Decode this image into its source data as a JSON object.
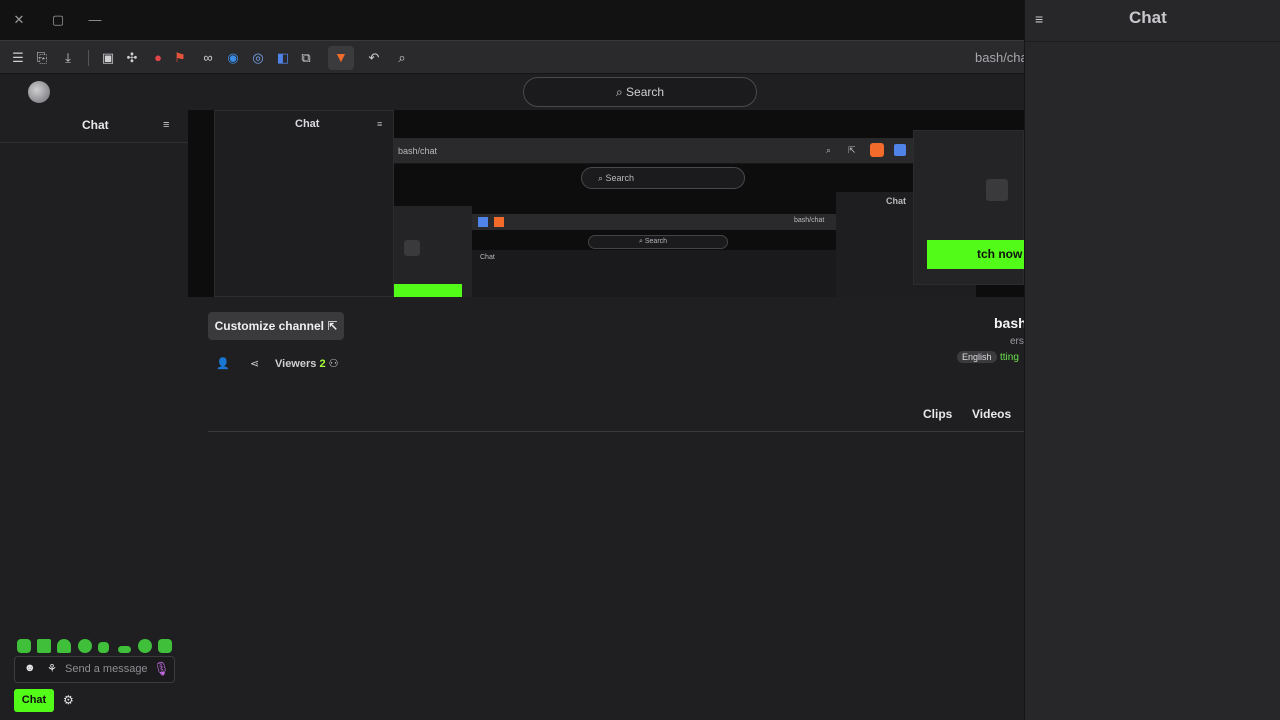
{
  "browser": {
    "url": "bash/chat",
    "window_controls": {
      "close": "✕",
      "restore": "▢",
      "minimize": "—"
    }
  },
  "search": {
    "label": "Search"
  },
  "left_chat": {
    "title": "Chat"
  },
  "right_chat": {
    "title": "Chat"
  },
  "video": {
    "inner_url": "bash/chat",
    "inner_search": "Search",
    "inner_chat": "Chat",
    "inner_watch": "tch now",
    "nested_url": "bash/chat",
    "nested_search": "Search",
    "nested_chat": "Chat"
  },
  "channel": {
    "name": "bash",
    "followers_text": "ers",
    "category": "tting",
    "language": "English",
    "customize_label": "Customize channel",
    "viewers_count": "2",
    "viewers_label": "Viewers"
  },
  "tabs": [
    {
      "label": "Videos"
    },
    {
      "label": "Clips"
    }
  ],
  "chat_input": {
    "placeholder": "Send a message",
    "chat_button": "Chat"
  },
  "colors": {
    "accent": "#53fc18",
    "background": "#1f1f22",
    "panel": "#27272a"
  }
}
